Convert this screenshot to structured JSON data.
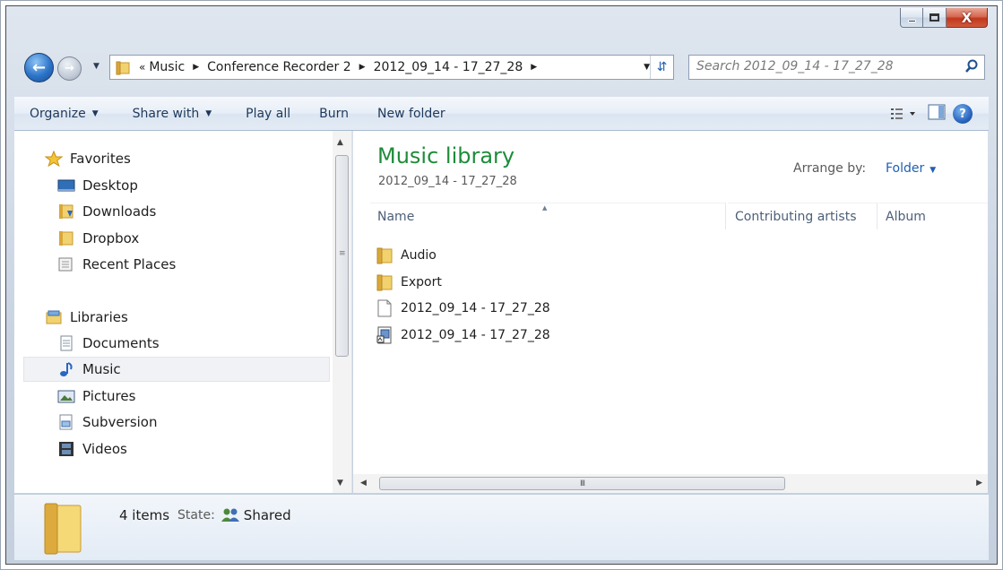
{
  "window": {
    "caption": {
      "minimize": "",
      "maximize": "",
      "close": "X"
    }
  },
  "address": {
    "overflow": "«",
    "crumbs": [
      "Music",
      "Conference Recorder 2",
      "2012_09_14 - 17_27_28"
    ],
    "separator": "▶"
  },
  "search": {
    "placeholder": "Search 2012_09_14 - 17_27_28"
  },
  "toolbar": {
    "organize": "Organize",
    "share_with": "Share with",
    "play_all": "Play all",
    "burn": "Burn",
    "new_folder": "New folder"
  },
  "nav": {
    "favorites": {
      "header": "Favorites",
      "items": [
        {
          "label": "Desktop",
          "icon": "desktop-icon"
        },
        {
          "label": "Downloads",
          "icon": "downloads-folder-icon"
        },
        {
          "label": "Dropbox",
          "icon": "folder-icon"
        },
        {
          "label": "Recent Places",
          "icon": "recent-places-icon"
        }
      ]
    },
    "libraries": {
      "header": "Libraries",
      "items": [
        {
          "label": "Documents",
          "icon": "documents-icon"
        },
        {
          "label": "Music",
          "icon": "music-note-icon",
          "selected": true
        },
        {
          "label": "Pictures",
          "icon": "pictures-icon"
        },
        {
          "label": "Subversion",
          "icon": "subversion-icon"
        },
        {
          "label": "Videos",
          "icon": "videos-icon"
        }
      ]
    }
  },
  "content": {
    "title": "Music library",
    "subtitle": "2012_09_14 - 17_27_28",
    "arrange_label": "Arrange by:",
    "arrange_value": "Folder",
    "columns": [
      "Name",
      "Contributing artists",
      "Album"
    ],
    "files": [
      {
        "name": "Audio",
        "icon": "folder-icon"
      },
      {
        "name": "Export",
        "icon": "folder-icon"
      },
      {
        "name": "2012_09_14 - 17_27_28",
        "icon": "blank-file-icon"
      },
      {
        "name": "2012_09_14 - 17_27_28",
        "icon": "project-file-icon"
      }
    ]
  },
  "details": {
    "count": "4 items",
    "state_label": "State:",
    "state_value": "Shared"
  },
  "colors": {
    "library_title": "#1e8c3a",
    "link_blue": "#1f5fb4",
    "close_red": "#c0381d"
  }
}
